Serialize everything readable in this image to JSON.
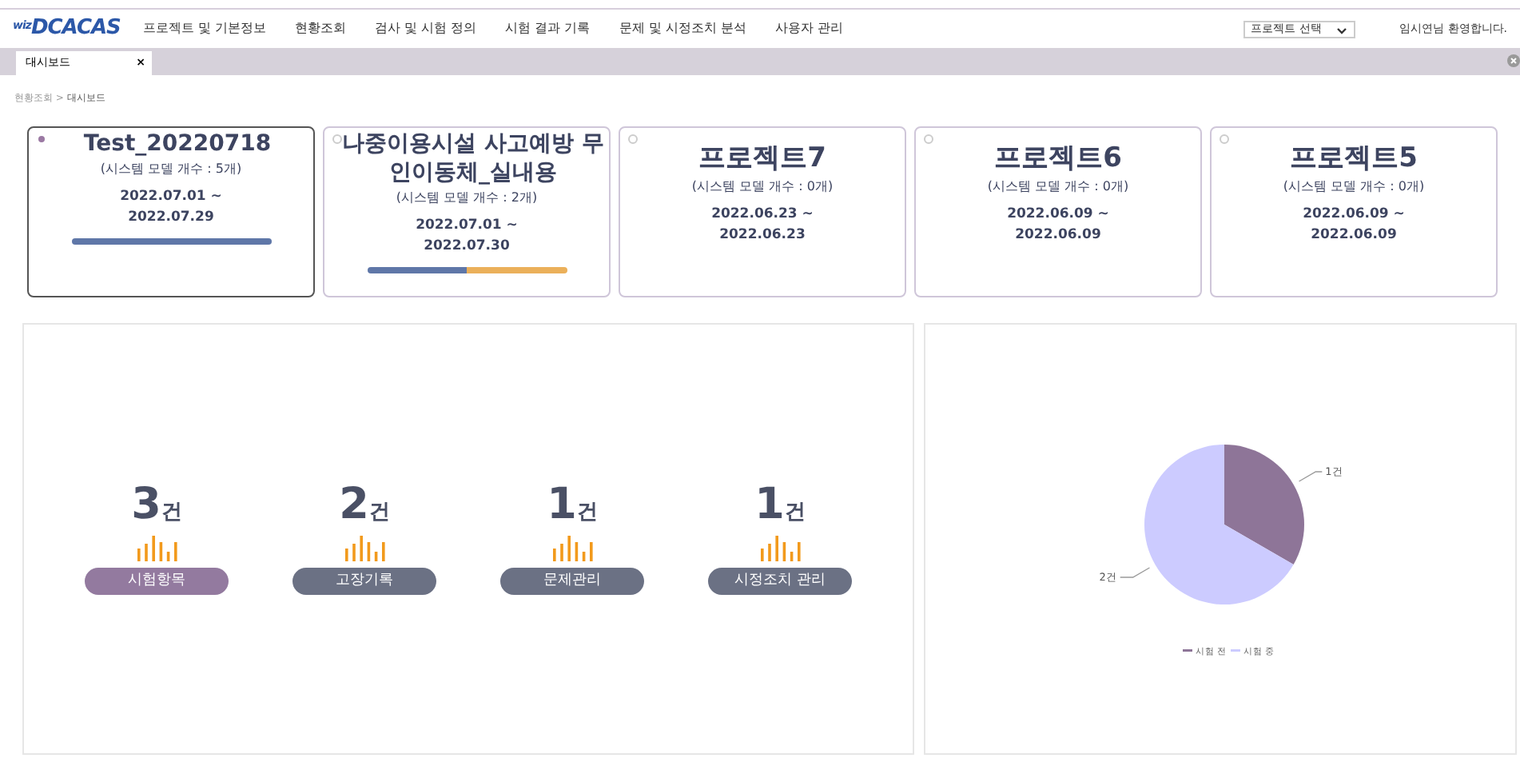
{
  "header": {
    "logo": {
      "prefix": "wiz",
      "name": "DCACAS"
    },
    "menu": [
      {
        "label": "프로젝트 및 기본정보"
      },
      {
        "label": "현황조회"
      },
      {
        "label": "검사 및 시험 정의"
      },
      {
        "label": "시험 결과 기록"
      },
      {
        "label": "문제 및 시정조치 분석"
      },
      {
        "label": "사용자 관리"
      }
    ],
    "project_select": {
      "value": "프로젝트 선택"
    },
    "greeting": "임시연님 환영합니다."
  },
  "tabs": [
    {
      "label": "대시보드",
      "close": "×",
      "selected": true
    }
  ],
  "breadcrumb": [
    "현황조회",
    "대시보드"
  ],
  "breadcrumb_separator": ">",
  "projects": [
    {
      "title": "Test_20220718",
      "models": "(시스템 모델 개수 : 5개)",
      "start": "2022.07.01 ~",
      "end": "2022.07.29",
      "selected": true,
      "bars": [
        {
          "level": 1,
          "color": "#5f77a8"
        }
      ]
    },
    {
      "title": "나중이용시설 사고예방 무인이동체_실내용",
      "models": "(시스템 모델 개수 : 2개)",
      "start": "2022.07.01 ~",
      "end": "2022.07.30",
      "selected": false,
      "bars": [
        {
          "level": 0.5,
          "color": "#5f77a8"
        },
        {
          "level": 0.5,
          "color": "#ebb05a"
        }
      ]
    },
    {
      "title": "프로젝트7",
      "models": "(시스템 모델 개수 : 0개)",
      "start": "2022.06.23 ~",
      "end": "2022.06.23",
      "selected": false
    },
    {
      "title": "프로젝트6",
      "models": "(시스템 모델 개수 : 0개)",
      "start": "2022.06.09 ~",
      "end": "2022.06.09",
      "selected": false
    },
    {
      "title": "프로젝트5",
      "models": "(시스템 모델 개수 : 0개)",
      "start": "2022.06.09 ~",
      "end": "2022.06.09",
      "selected": false
    }
  ],
  "stats": [
    {
      "value": "3",
      "unit": "건",
      "label": "시험항목",
      "selected": true
    },
    {
      "value": "2",
      "unit": "건",
      "label": "고장기록",
      "selected": false
    },
    {
      "value": "1",
      "unit": "건",
      "label": "문제관리",
      "selected": false
    },
    {
      "value": "1",
      "unit": "건",
      "label": "시정조치 관리",
      "selected": false
    }
  ],
  "chart_data": {
    "type": "pie",
    "categories": [
      "시험 전",
      "시험 중"
    ],
    "values": [
      1,
      2
    ],
    "colors": [
      "#8e7598",
      "#cccbff"
    ],
    "value_labels": [
      "1건",
      "2건"
    ],
    "legend": "bottom"
  }
}
